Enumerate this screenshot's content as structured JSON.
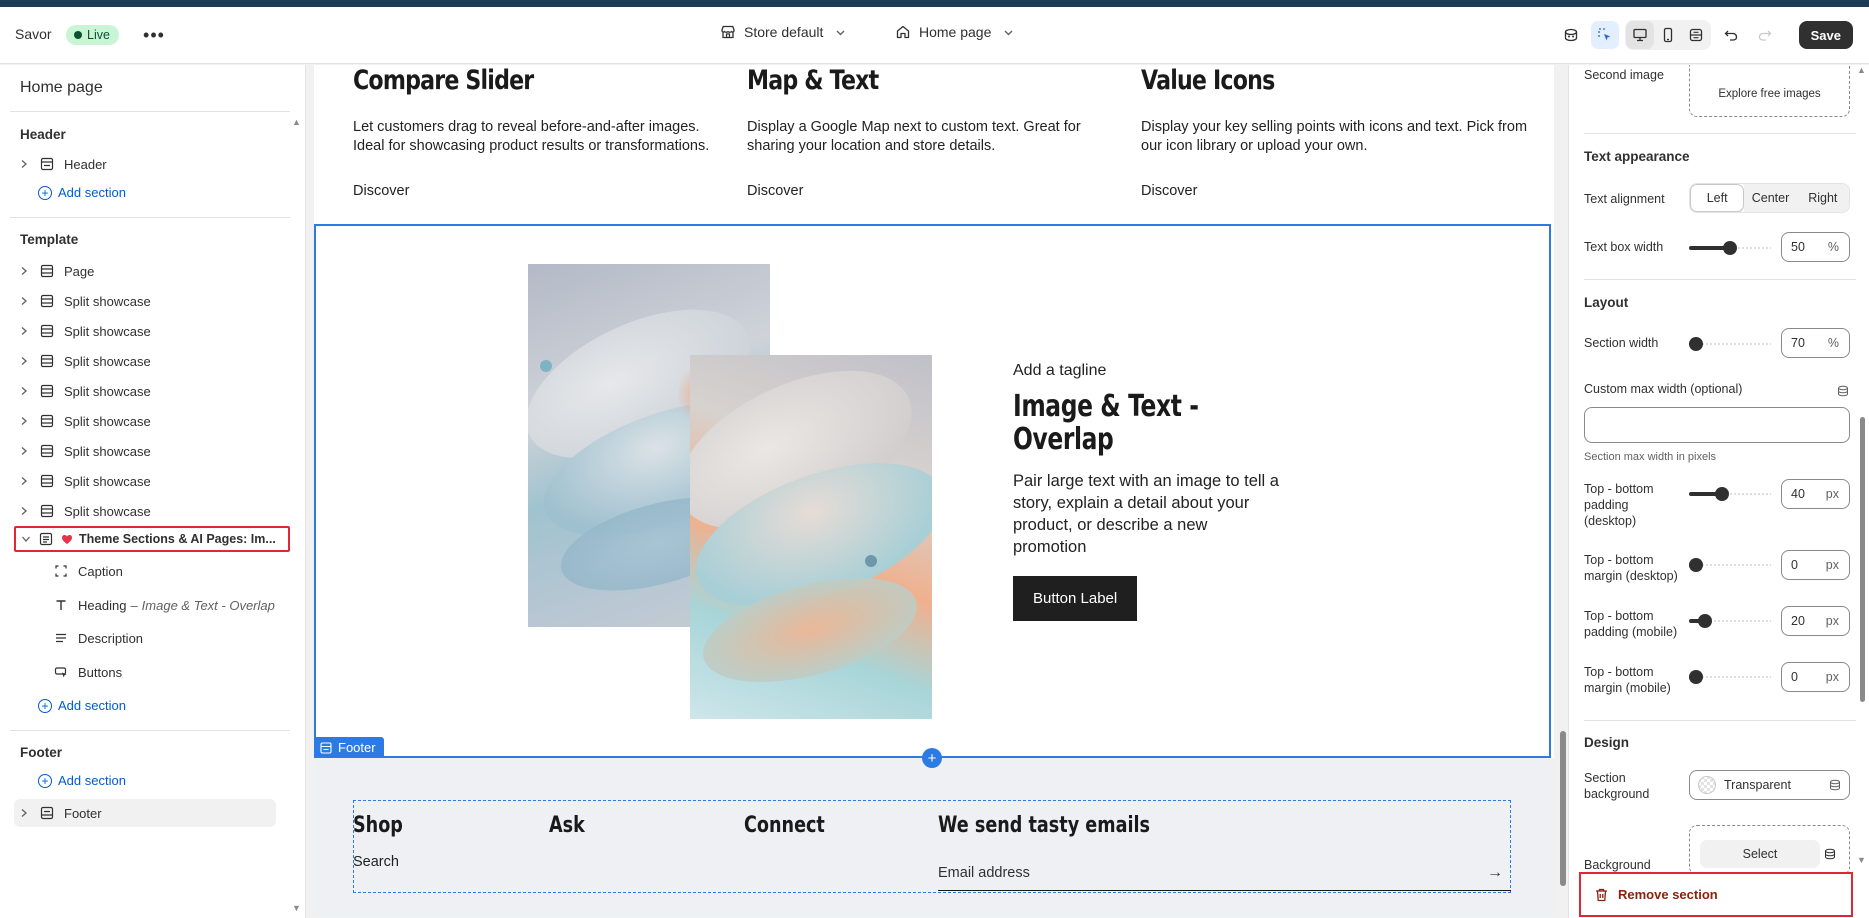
{
  "topbar": {
    "brand": "Savor",
    "live_label": "Live",
    "more_glyph": "•••",
    "store_select": "Store default",
    "page_select": "Home page",
    "save_label": "Save",
    "icons": [
      "theme-icon",
      "select-cursor-icon",
      "desktop-icon",
      "mobile-icon",
      "fullscreen-icon",
      "undo-icon",
      "redo-icon"
    ]
  },
  "left": {
    "title": "Home page",
    "groups": {
      "header": {
        "title": "Header",
        "items": [
          "Header"
        ],
        "add_label": "Add section"
      },
      "template": {
        "title": "Template",
        "items": [
          "Page",
          "Split showcase",
          "Split showcase",
          "Split showcase",
          "Split showcase",
          "Split showcase",
          "Split showcase",
          "Split showcase",
          "Split showcase"
        ],
        "selected": "Theme Sections & AI Pages: Im...",
        "children": [
          {
            "label": "Caption",
            "icon": "caption-icon"
          },
          {
            "label": "Heading",
            "sub": "Image & Text - Overlap",
            "icon": "text-icon"
          },
          {
            "label": "Description",
            "icon": "paragraph-icon"
          },
          {
            "label": "Buttons",
            "icon": "button-icon"
          }
        ],
        "add_label": "Add section"
      },
      "footer": {
        "title": "Footer",
        "add_label": "Add section",
        "items": [
          "Footer"
        ]
      }
    }
  },
  "canvas": {
    "columns": [
      {
        "title": "Compare Slider",
        "text": "Let customers drag to reveal before-and-after images. Ideal for showcasing product results or transformations.",
        "link": "Discover"
      },
      {
        "title": "Map & Text",
        "text": "Display a Google Map next to custom text. Great for sharing your location and store details.",
        "link": "Discover"
      },
      {
        "title": "Value Icons",
        "text": "Display your key selling points with icons and text. Pick from our icon library or upload your own.",
        "link": "Discover"
      }
    ],
    "overlap": {
      "tagline": "Add a tagline",
      "title": "Image & Text - Overlap",
      "description": "Pair large text with an image to tell a story, explain a detail about your product, or describe a new promotion",
      "button": "Button Label"
    },
    "footer_tag": "Footer",
    "plus_glyph": "+",
    "footer": {
      "columns": [
        "Shop",
        "Ask",
        "Connect"
      ],
      "shop_link": "Search",
      "newsletter_title": "We send tasty emails",
      "email_placeholder": "Email address",
      "submit_glyph": "→"
    }
  },
  "right": {
    "second_image_label": "Second image",
    "explore_label": "Explore free images",
    "text_appearance": {
      "title": "Text appearance",
      "alignment_label": "Text alignment",
      "alignment_options": [
        "Left",
        "Center",
        "Right"
      ],
      "alignment_selected": "Left",
      "box_width_label": "Text box width",
      "box_width_value": "50",
      "box_width_unit": "%",
      "box_width_fraction": 0.5
    },
    "layout": {
      "title": "Layout",
      "section_width_label": "Section width",
      "section_width_value": "70",
      "section_width_unit": "%",
      "section_width_fraction": 0.0,
      "custom_max_label": "Custom max width (optional)",
      "custom_max_help": "Section max width in pixels",
      "pad_desktop_label": "Top - bottom padding (desktop)",
      "pad_desktop_value": "40",
      "pad_desktop_fraction": 0.4,
      "margin_desktop_label": "Top - bottom margin (desktop)",
      "margin_desktop_value": "0",
      "margin_desktop_fraction": 0.0,
      "pad_mobile_label": "Top - bottom padding (mobile)",
      "pad_mobile_value": "20",
      "pad_mobile_fraction": 0.2,
      "margin_mobile_label": "Top - bottom margin (mobile)",
      "margin_mobile_value": "0",
      "margin_mobile_fraction": 0.0,
      "px_unit": "px"
    },
    "design": {
      "title": "Design",
      "bg_label": "Section background",
      "bg_value": "Transparent",
      "background_label": "Background",
      "select_label": "Select"
    },
    "remove_label": "Remove section"
  },
  "colors": {
    "accent": "#2c7be5",
    "link": "#005bd3",
    "highlight": "#e32636",
    "live_bg": "#c9f5d4"
  }
}
